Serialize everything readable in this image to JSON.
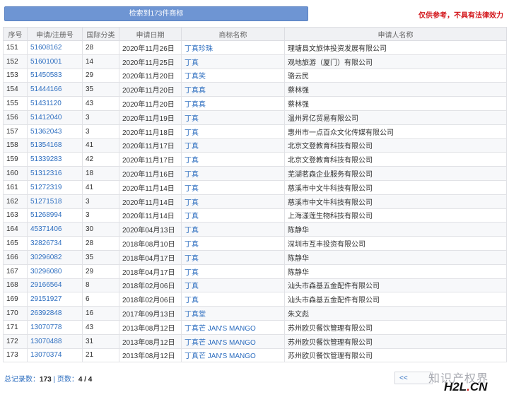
{
  "search_button_label": "检索到173件商标",
  "disclaimer": "仅供参考，不具有法律效力",
  "table": {
    "headers": [
      "序号",
      "申请/注册号",
      "国际分类",
      "申请日期",
      "商标名称",
      "申请人名称"
    ],
    "rows": [
      [
        "151",
        "51608162",
        "28",
        "2020年11月26日",
        "丁真珍珠",
        "理塘县文旅体投资发展有限公司"
      ],
      [
        "152",
        "51601001",
        "14",
        "2020年11月25日",
        "丁真",
        "观地旅游（厦门）有限公司"
      ],
      [
        "153",
        "51450583",
        "29",
        "2020年11月20日",
        "丁真笑",
        "骆云民"
      ],
      [
        "154",
        "51444166",
        "35",
        "2020年11月20日",
        "丁真真",
        "蔡林强"
      ],
      [
        "155",
        "51431120",
        "43",
        "2020年11月20日",
        "丁真真",
        "蔡林强"
      ],
      [
        "156",
        "51412040",
        "3",
        "2020年11月19日",
        "丁真",
        "温州昇亿贸易有限公司"
      ],
      [
        "157",
        "51362043",
        "3",
        "2020年11月18日",
        "丁真",
        "惠州市一点百众文化传媒有限公司"
      ],
      [
        "158",
        "51354168",
        "41",
        "2020年11月17日",
        "丁真",
        "北京文登教育科技有限公司"
      ],
      [
        "159",
        "51339283",
        "42",
        "2020年11月17日",
        "丁真",
        "北京文登教育科技有限公司"
      ],
      [
        "160",
        "51312316",
        "18",
        "2020年11月16日",
        "丁真",
        "芜湖茗森企业服务有限公司"
      ],
      [
        "161",
        "51272319",
        "41",
        "2020年11月14日",
        "丁真",
        "慈溪市中文牛科技有限公司"
      ],
      [
        "162",
        "51271518",
        "3",
        "2020年11月14日",
        "丁真",
        "慈溪市中文牛科技有限公司"
      ],
      [
        "163",
        "51268994",
        "3",
        "2020年11月14日",
        "丁真",
        "上海漾莲生物科技有限公司"
      ],
      [
        "164",
        "45371406",
        "30",
        "2020年04月13日",
        "丁真",
        "陈静华"
      ],
      [
        "165",
        "32826734",
        "28",
        "2018年08月10日",
        "丁真",
        "深圳市互丰投资有限公司"
      ],
      [
        "166",
        "30296082",
        "35",
        "2018年04月17日",
        "丁真",
        "陈静华"
      ],
      [
        "167",
        "30296080",
        "29",
        "2018年04月17日",
        "丁真",
        "陈静华"
      ],
      [
        "168",
        "29166564",
        "8",
        "2018年02月06日",
        "丁真",
        "汕头市森基五金配件有限公司"
      ],
      [
        "169",
        "29151927",
        "6",
        "2018年02月06日",
        "丁真",
        "汕头市森基五金配件有限公司"
      ],
      [
        "170",
        "26392848",
        "16",
        "2017年09月13日",
        "丁真堂",
        "朱文彪"
      ],
      [
        "171",
        "13070778",
        "43",
        "2013年08月12日",
        "丁真芒 JAN'S MANGO",
        "苏州欧贝餐饮管理有限公司"
      ],
      [
        "172",
        "13070488",
        "31",
        "2013年08月12日",
        "丁真芒 JAN'S MANGO",
        "苏州欧贝餐饮管理有限公司"
      ],
      [
        "173",
        "13070374",
        "21",
        "2013年08月12日",
        "丁真芒 JAN'S MANGO",
        "苏州欧贝餐饮管理有限公司"
      ]
    ]
  },
  "footer": {
    "total_label": "总记录数：",
    "total_value": "173",
    "separator": " | ",
    "pages_label": "页数：",
    "pages_value": "4 / 4"
  },
  "pager": {
    "prev_label": "<<"
  },
  "watermark": {
    "text": "知识产权界",
    "logo_prefix": "H2L",
    "logo_dot": ".",
    "logo_suffix": "CN"
  }
}
